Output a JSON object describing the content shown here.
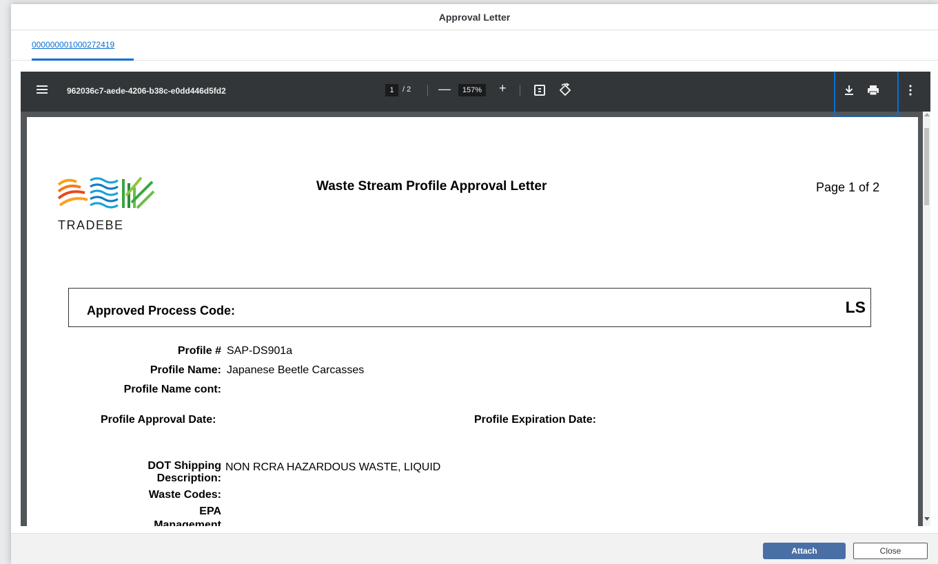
{
  "dialog": {
    "title": "Approval Letter",
    "tab_label": "000000001000272419"
  },
  "viewer": {
    "doc_title": "962036c7-aede-4206-b38c-e0dd446d5fd2",
    "current_page": "1",
    "page_sep": "/ 2",
    "zoom_out": "—",
    "zoom": "157%",
    "zoom_in": "+",
    "icons": [
      "menu-icon",
      "fit-page-icon",
      "rotate-icon",
      "download-icon",
      "print-icon",
      "more-vert-icon"
    ]
  },
  "document": {
    "logo_text": "TRADEBE",
    "heading": "Waste Stream Profile Approval Letter",
    "page_of": "Page 1 of 2",
    "approved_process_code_label": "Approved Process Code:",
    "approved_process_code": "LS",
    "profile_no_label": "Profile #",
    "profile_no": "SAP-DS901a",
    "profile_name_label": "Profile Name:",
    "profile_name": "Japanese Beetle Carcasses",
    "profile_name_cont_label": "Profile Name cont:",
    "approval_date_label": "Profile Approval Date:",
    "expiration_date_label": "Profile Expiration Date:",
    "dot_label_1": "DOT Shipping",
    "dot_label_2": "Description:",
    "dot_value": "NON RCRA HAZARDOUS WASTE, LIQUID",
    "waste_codes_label": "Waste Codes:",
    "epa_label": "EPA",
    "management_label": "Management"
  },
  "footer": {
    "attach_label": "Attach",
    "close_label": "Close"
  },
  "colors": {
    "accent": "#0a6ed1",
    "toolbar": "#323639",
    "viewer_bg": "#525659",
    "attach_button": "#4a6fa5"
  }
}
